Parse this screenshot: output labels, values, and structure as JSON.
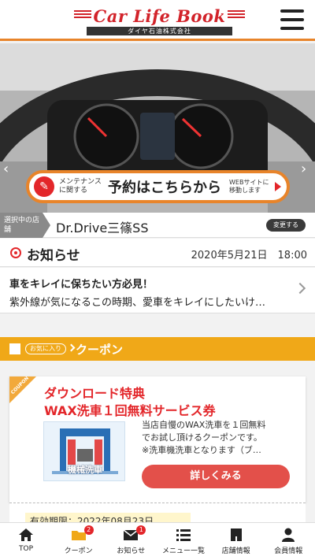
{
  "header": {
    "logo_text": "Car Life Book",
    "logo_sub": "ダイヤ石油株式会社"
  },
  "hero": {
    "banner_small_left": "メンテナンスに関する",
    "banner_main": "予約はこちらから",
    "banner_small_right": "WEBサイトに移動します"
  },
  "store": {
    "tag": "選択中の店舗",
    "name": "Dr.Drive三篠SS",
    "change_label": "変更する"
  },
  "news": {
    "title": "お知らせ",
    "date": "2020年5月21日　18:00",
    "item_title": "車をキレイに保ちたい方必見！",
    "item_body": "紫外線が気になるこの時期、愛車をキレイにしたいけ…"
  },
  "coupon": {
    "fav_label": "お気に入り",
    "title": "クーポン",
    "corner": "COUPON",
    "card_title1": "ダウンロード特典",
    "card_title2": "WAX洗車１回無料サービス券",
    "image_caption": "機械洗車",
    "desc_lines": [
      "当店自慢のWAX洗車を１回無料",
      "でお試し頂けるクーポンです。",
      "※洗車機洗車となります（ブ…"
    ],
    "detail_label": "詳しくみる",
    "expiry": "有効期限：2022年08月23日"
  },
  "nav": {
    "items": [
      {
        "label": "TOP",
        "icon": "home-icon"
      },
      {
        "label": "クーポン",
        "icon": "coupon-icon",
        "badge": "2"
      },
      {
        "label": "お知らせ",
        "icon": "mail-icon",
        "badge": "1"
      },
      {
        "label": "メニュー一覧",
        "icon": "list-icon"
      },
      {
        "label": "店舗情報",
        "icon": "shop-icon"
      },
      {
        "label": "会員情報",
        "icon": "person-icon"
      }
    ]
  },
  "colors": {
    "accent_orange": "#e8842a",
    "brand_red": "#e3262a",
    "coupon_yellow": "#f0a818"
  }
}
